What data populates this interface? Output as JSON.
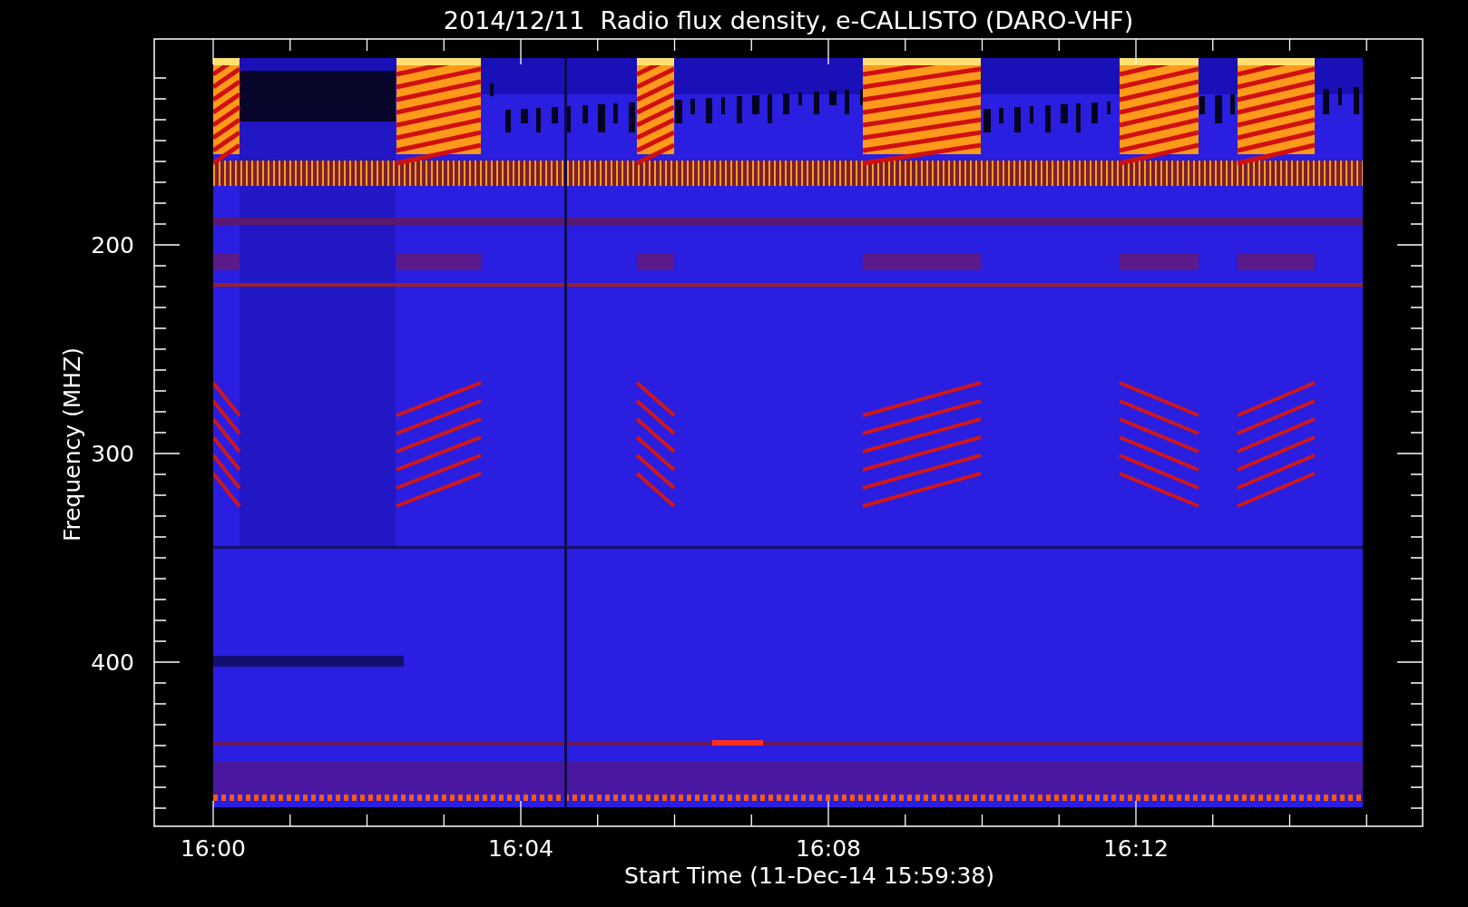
{
  "title": "2014/12/11  Radio flux density, e-CALLISTO (DARO-VHF)",
  "y_axis": {
    "label": "Frequency (MHZ)",
    "tick_labels": [
      "200",
      "300",
      "400"
    ]
  },
  "x_axis": {
    "label": "Start Time (11-Dec-14 15:59:38)",
    "tick_labels": [
      "16:00",
      "16:04",
      "16:08",
      "16:12"
    ]
  }
}
